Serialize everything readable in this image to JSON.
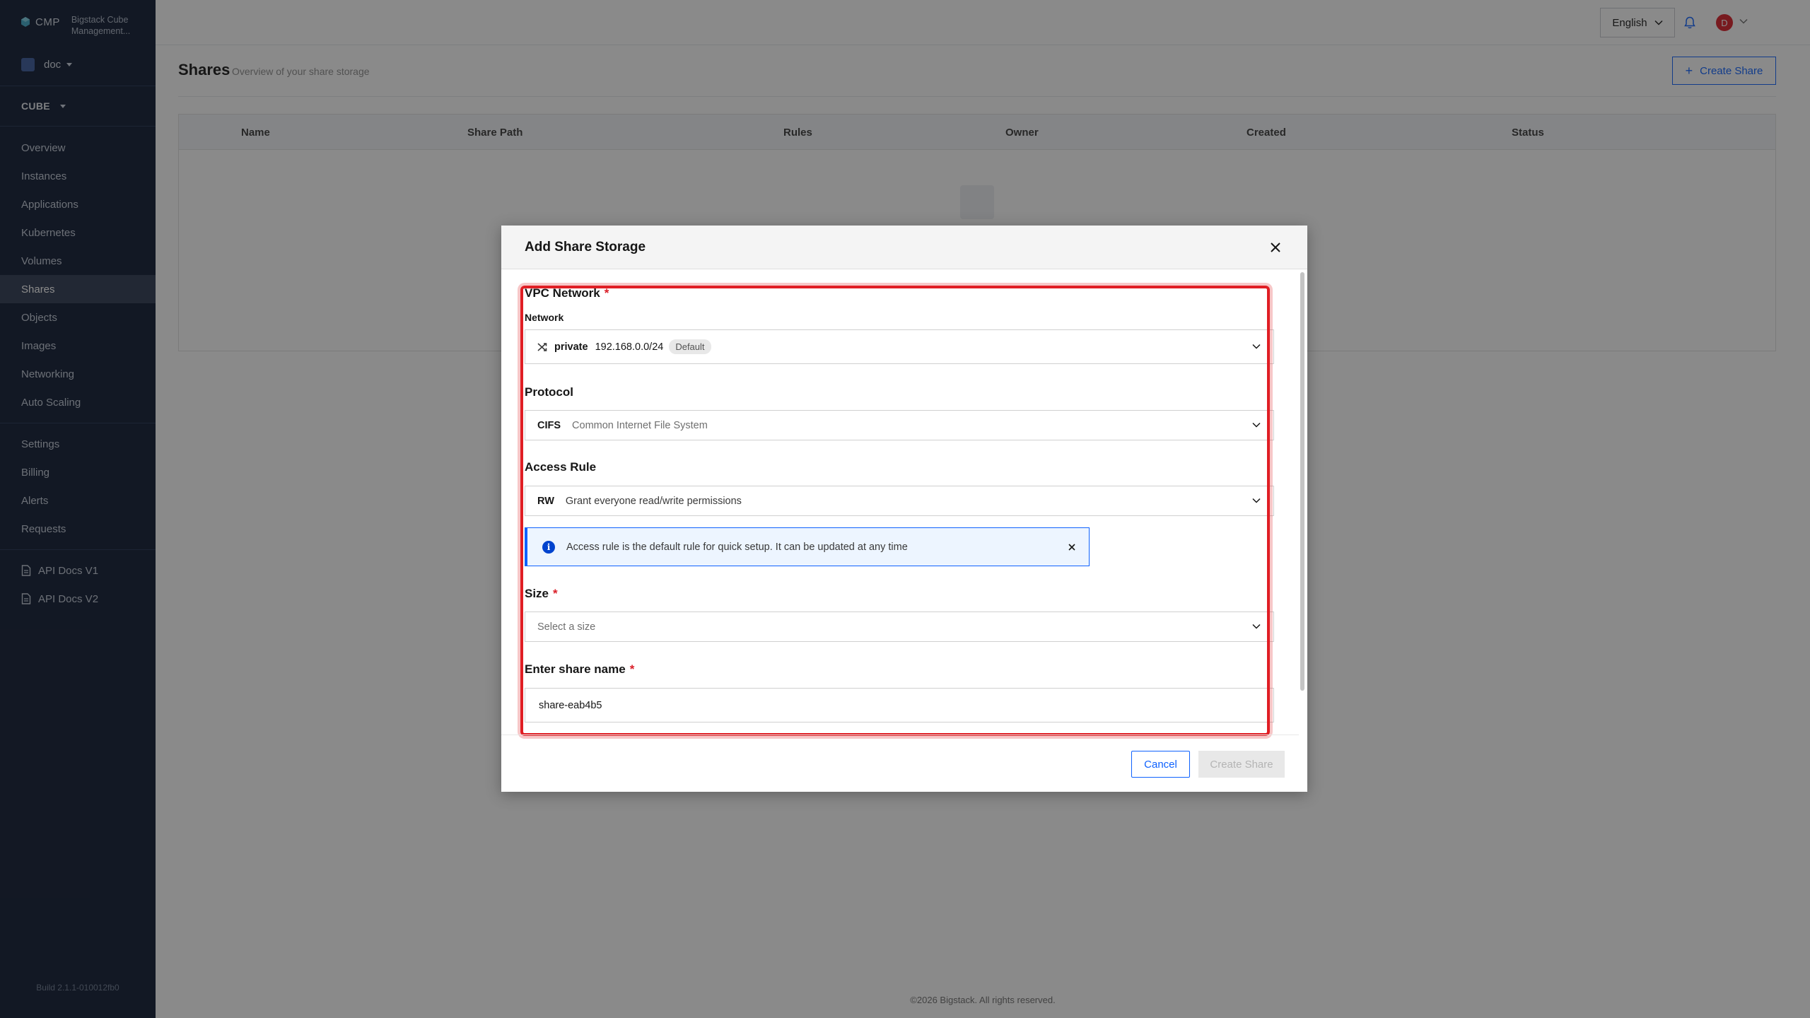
{
  "brand": {
    "short": "CMP",
    "name": "Bigstack Cube Management..."
  },
  "project": {
    "name": "doc"
  },
  "section": {
    "name": "CUBE"
  },
  "nav": {
    "overview": "Overview",
    "instances": "Instances",
    "applications": "Applications",
    "kubernetes": "Kubernetes",
    "volumes": "Volumes",
    "shares": "Shares",
    "objects": "Objects",
    "images": "Images",
    "networking": "Networking",
    "auto_scaling": "Auto Scaling",
    "settings": "Settings",
    "billing": "Billing",
    "alerts": "Alerts",
    "requests": "Requests",
    "api_v1": "API Docs V1",
    "api_v2": "API Docs V2"
  },
  "build": "Build 2.1.1-010012fb0",
  "topbar": {
    "language": "English",
    "avatar_initial": "D"
  },
  "page": {
    "title": "Shares",
    "subtitle": "Overview of your share storage",
    "create_button": "Create Share"
  },
  "table": {
    "columns": [
      "Name",
      "Share Path",
      "Rules",
      "Owner",
      "Created",
      "Status"
    ]
  },
  "footer": "©2026 Bigstack. All rights reserved.",
  "modal": {
    "title": "Add Share Storage",
    "vpc": {
      "label": "VPC Network",
      "sub_label": "Network",
      "name": "private",
      "cidr": "192.168.0.0/24",
      "tag": "Default"
    },
    "protocol": {
      "label": "Protocol",
      "code": "CIFS",
      "desc": "Common Internet File System"
    },
    "access_rule": {
      "label": "Access Rule",
      "code": "RW",
      "desc": "Grant everyone read/write permissions"
    },
    "info": "Access rule is the default rule for quick setup. It can be updated at any time",
    "size": {
      "label": "Size",
      "placeholder": "Select a size"
    },
    "share_name": {
      "label": "Enter share name",
      "value": "share-eab4b5"
    },
    "cancel": "Cancel",
    "create": "Create Share"
  },
  "colors": {
    "sidebar": "#0f1b33",
    "primary": "#0f62fe",
    "highlight": "#e01e24",
    "required": "#da1e28"
  }
}
